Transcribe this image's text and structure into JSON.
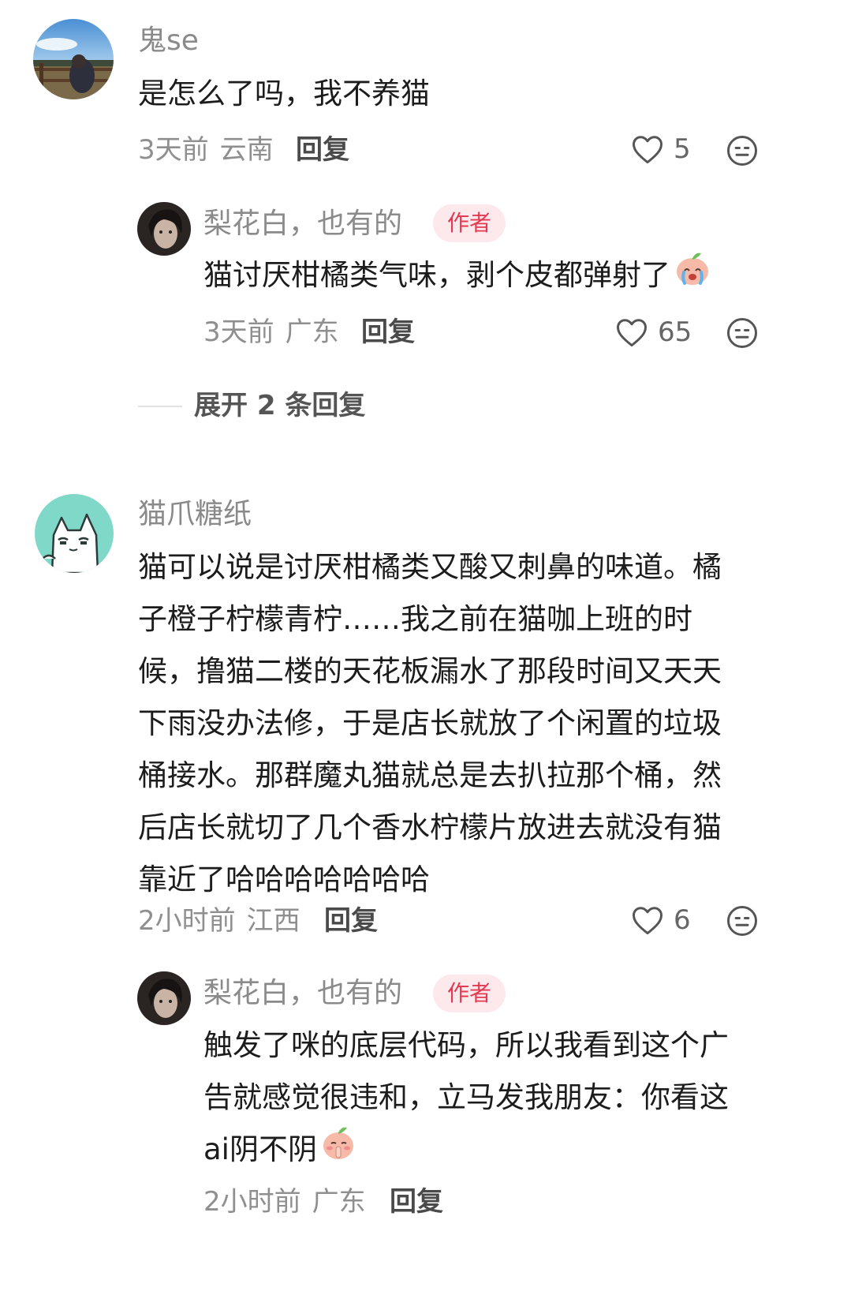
{
  "comments": [
    {
      "user": "鬼se",
      "text_lines": [
        "是怎么了吗，我不养猫"
      ],
      "time": "3天前",
      "location": "云南",
      "reply_label": "回复",
      "likes": "5",
      "sub": {
        "user": "梨花白，也有的",
        "author_tag": "作者",
        "text_lines": [
          "猫讨厌柑橘类气味，剥个皮都弹射了"
        ],
        "time": "3天前",
        "location": "广东",
        "reply_label": "回复",
        "likes": "65"
      },
      "expand": "展开 2 条回复"
    },
    {
      "user": "猫爪糖纸",
      "text_lines": [
        "猫可以说是讨厌柑橘类又酸又刺鼻的味道。橘",
        "子橙子柠檬青柠……我之前在猫咖上班的时",
        "候，撸猫二楼的天花板漏水了那段时间又天天",
        "下雨没办法修，于是店长就放了个闲置的垃圾",
        "桶接水。那群魔丸猫就总是去扒拉那个桶，然",
        "后店长就切了几个香水柠檬片放进去就没有猫",
        "靠近了哈哈哈哈哈哈哈"
      ],
      "time": "2小时前",
      "location": "江西",
      "reply_label": "回复",
      "likes": "6",
      "sub": {
        "user": "梨花白，也有的",
        "author_tag": "作者",
        "text_lines": [
          "触发了咪的底层代码，所以我看到这个广",
          "告就感觉很违和，立马发我朋友：你看这",
          "ai阴不阴"
        ],
        "time": "2小时前",
        "location": "广东",
        "reply_label": "回复"
      }
    }
  ],
  "icons": {
    "like": "heart-outline-icon",
    "react": "smiley-face-icon",
    "emoji_1": "crying-peach-emoji",
    "emoji_2": "shush-peach-emoji"
  },
  "colors": {
    "author_tag_bg": "#fde8ec",
    "author_tag_text": "#e33a52",
    "username": "#8a8a8a"
  }
}
